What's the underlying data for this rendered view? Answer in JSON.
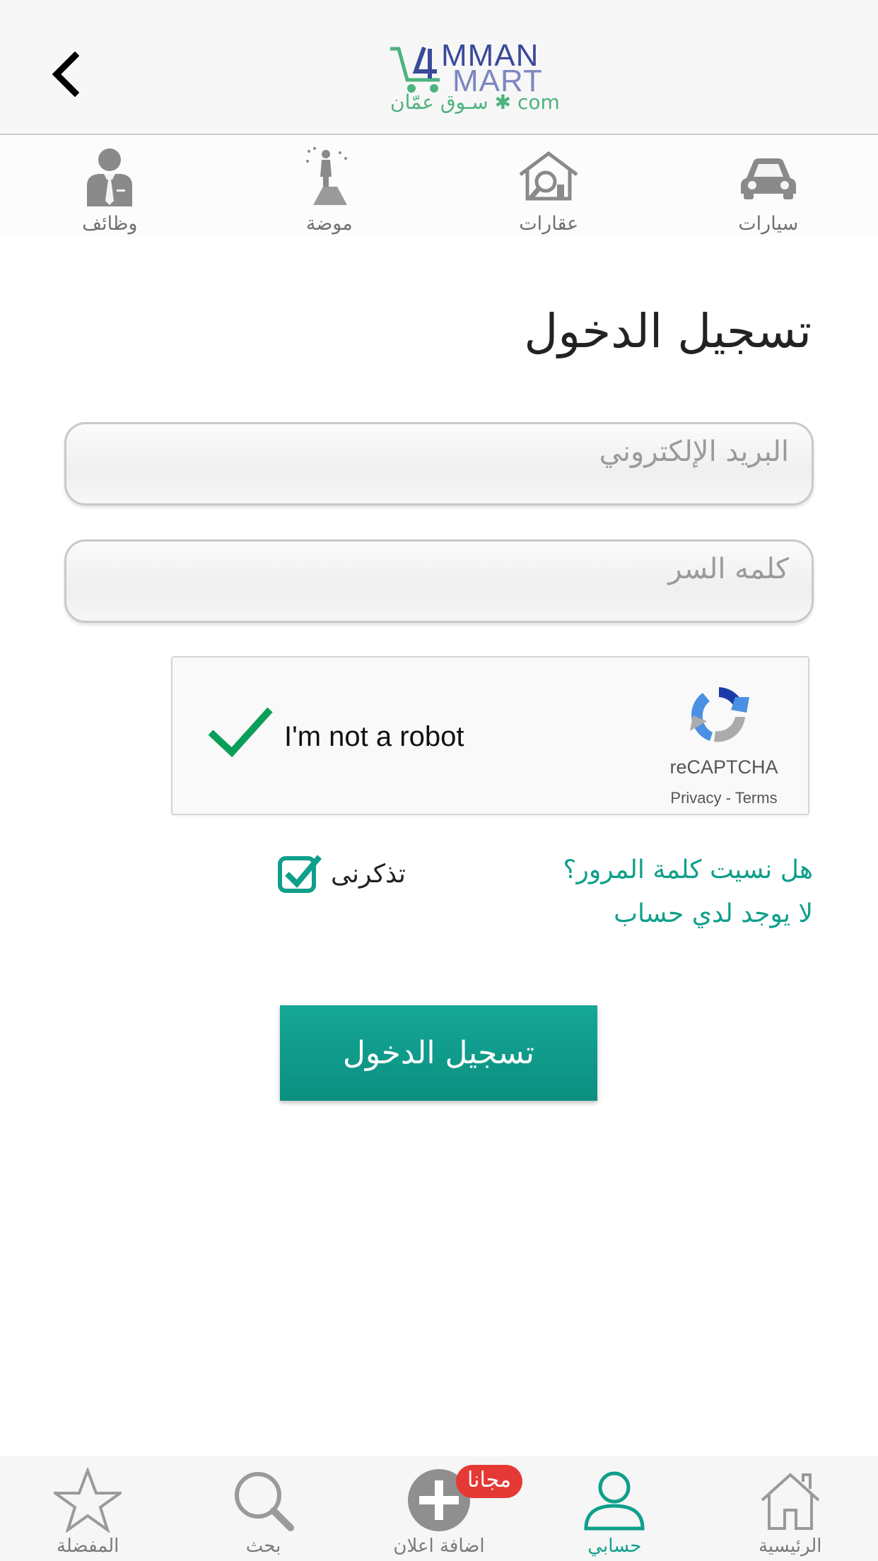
{
  "header": {
    "back_icon": "chevron-left-icon",
    "logo": {
      "line1": "MMAN",
      "line2": "MART",
      "subtitle": "سـوق عمّان ✱ com"
    }
  },
  "categories": [
    {
      "label": "سيارات",
      "icon": "car-icon"
    },
    {
      "label": "عقارات",
      "icon": "house-search-icon"
    },
    {
      "label": "موضة",
      "icon": "runway-model-icon"
    },
    {
      "label": "وظائف",
      "icon": "businessman-icon"
    }
  ],
  "login": {
    "title": "تسجيل الدخول",
    "email_placeholder": "البريد الإلكتروني",
    "password_placeholder": "كلمه السر",
    "forgot_password": "هل نسيت كلمة المرور؟",
    "no_account": "لا يوجد لدي حساب",
    "remember_me": "تذكرنى",
    "remember_checked": true,
    "submit_label": "تسجيل الدخول"
  },
  "recaptcha": {
    "checked": true,
    "text": "I'm not a robot",
    "brand": "reCAPTCHA",
    "privacy": "Privacy",
    "separator": " - ",
    "terms": "Terms"
  },
  "bottom_nav": {
    "items": [
      {
        "label": "الرئيسية",
        "icon": "home-icon",
        "active": false
      },
      {
        "label": "حسابي",
        "icon": "user-icon",
        "active": true
      },
      {
        "label": "اضافة اعلان",
        "icon": "add-circle-icon",
        "active": false,
        "badge": "مجانا"
      },
      {
        "label": "بحث",
        "icon": "search-icon",
        "active": false
      },
      {
        "label": "المفضلة",
        "icon": "star-icon",
        "active": false
      }
    ]
  },
  "colors": {
    "accent": "#0f9f8a",
    "badge": "#e53935",
    "recaptcha_check": "#0a9e5a",
    "logo_blue": "#3a4a9a",
    "logo_green": "#4db37e"
  }
}
